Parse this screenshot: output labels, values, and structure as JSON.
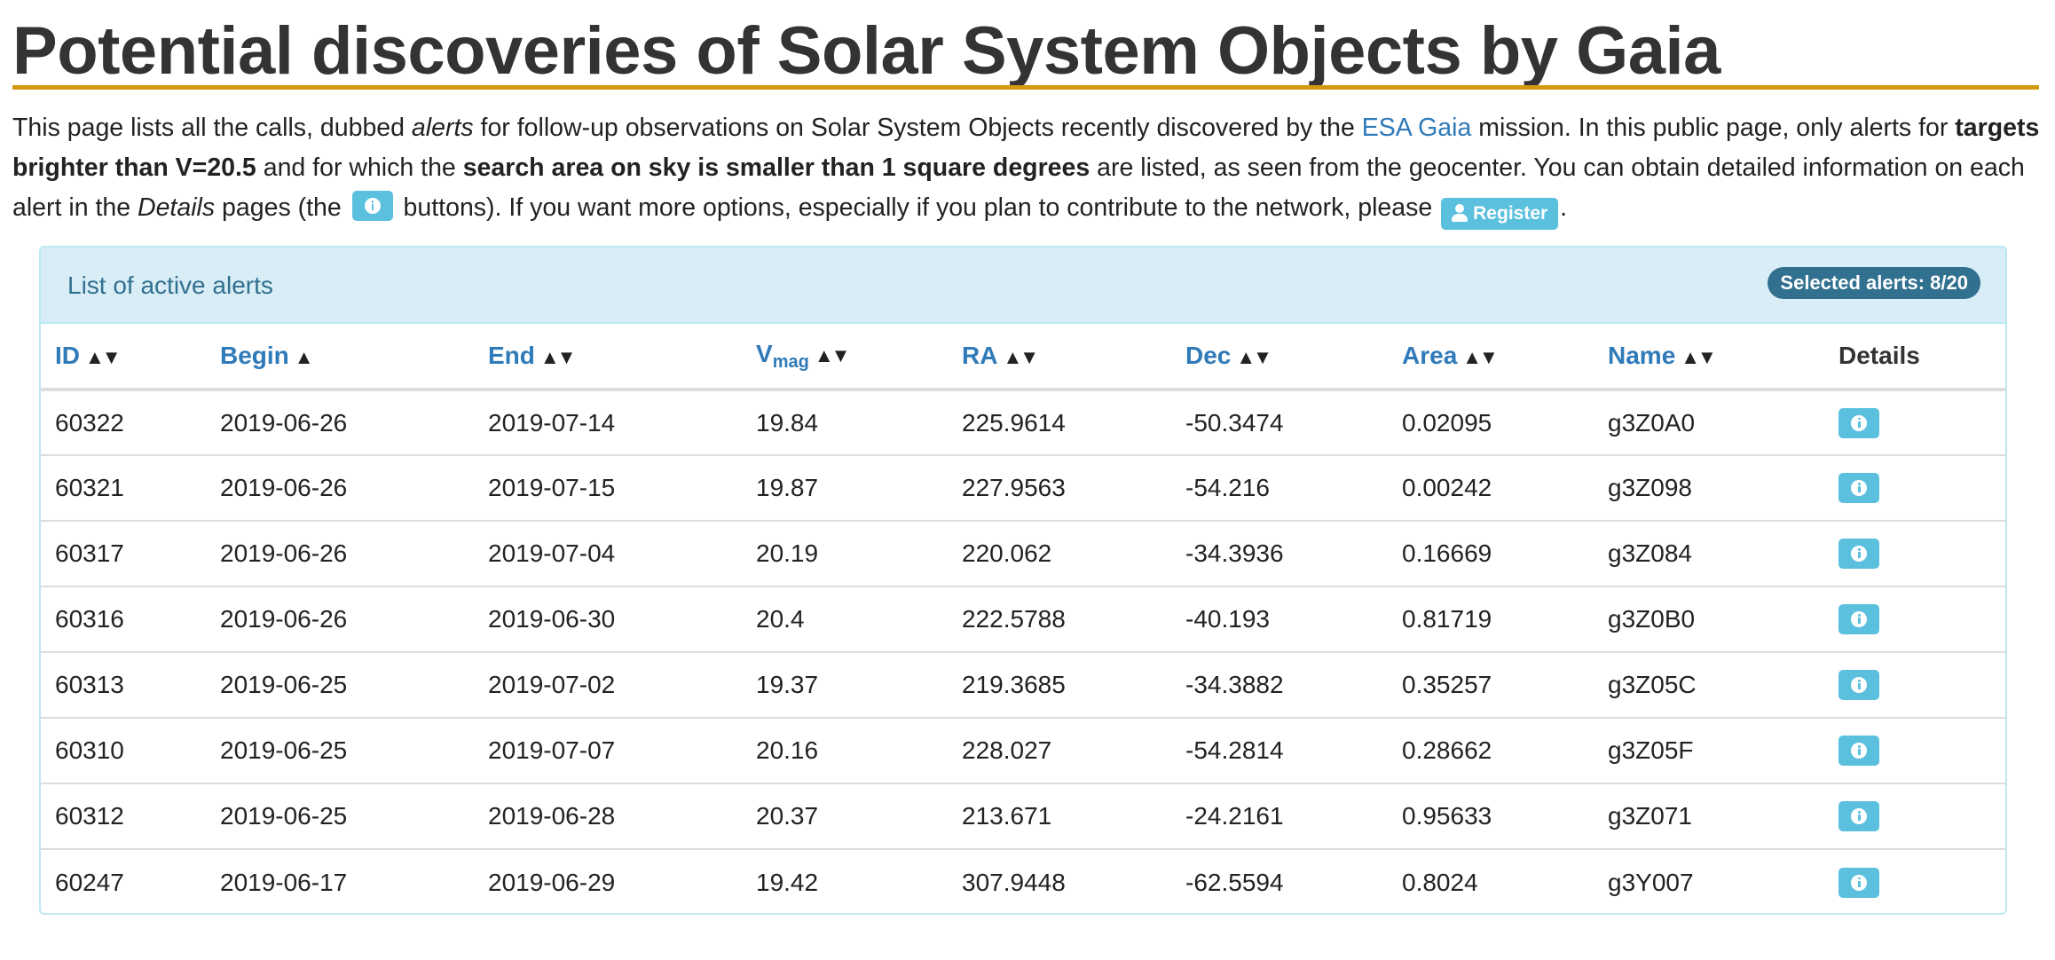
{
  "page": {
    "title": "Potential discoveries of Solar System Objects by Gaia"
  },
  "intro": {
    "t1": "This page lists all the calls, dubbed ",
    "t2_em": "alerts",
    "t3": " for follow-up observations on Solar System Objects recently discovered by the ",
    "link_esa": "ESA Gaia",
    "t4": " mission. In this public page, only alerts for ",
    "b1": "targets brighter than V=20.5",
    "t5": " and for which the ",
    "b2": "search area on sky is smaller than 1 square degrees",
    "t6": " are listed, as seen from the geocenter. You can obtain detailed information on each alert in the ",
    "em2": "Details",
    "t7": " pages (the ",
    "t8": " buttons). If you want more options, especially if you plan to contribute to the network, please ",
    "register_label": "Register",
    "t9": "."
  },
  "panel": {
    "title": "List of active alerts",
    "badge": "Selected alerts: 8/20"
  },
  "table": {
    "sort_arrows": "▲▼",
    "sort_up": "▲",
    "headers": {
      "id": "ID",
      "begin": "Begin",
      "end": "End",
      "vmag_main": "V",
      "vmag_sub": "mag",
      "ra": "RA",
      "dec": "Dec",
      "area": "Area",
      "name": "Name",
      "details": "Details"
    },
    "rows": [
      {
        "id": "60322",
        "begin": "2019-06-26",
        "end": "2019-07-14",
        "vmag": "19.84",
        "ra": "225.9614",
        "dec": "-50.3474",
        "area": "0.02095",
        "name": "g3Z0A0"
      },
      {
        "id": "60321",
        "begin": "2019-06-26",
        "end": "2019-07-15",
        "vmag": "19.87",
        "ra": "227.9563",
        "dec": "-54.216",
        "area": "0.00242",
        "name": "g3Z098"
      },
      {
        "id": "60317",
        "begin": "2019-06-26",
        "end": "2019-07-04",
        "vmag": "20.19",
        "ra": "220.062",
        "dec": "-34.3936",
        "area": "0.16669",
        "name": "g3Z084"
      },
      {
        "id": "60316",
        "begin": "2019-06-26",
        "end": "2019-06-30",
        "vmag": "20.4",
        "ra": "222.5788",
        "dec": "-40.193",
        "area": "0.81719",
        "name": "g3Z0B0"
      },
      {
        "id": "60313",
        "begin": "2019-06-25",
        "end": "2019-07-02",
        "vmag": "19.37",
        "ra": "219.3685",
        "dec": "-34.3882",
        "area": "0.35257",
        "name": "g3Z05C"
      },
      {
        "id": "60310",
        "begin": "2019-06-25",
        "end": "2019-07-07",
        "vmag": "20.16",
        "ra": "228.027",
        "dec": "-54.2814",
        "area": "0.28662",
        "name": "g3Z05F"
      },
      {
        "id": "60312",
        "begin": "2019-06-25",
        "end": "2019-06-28",
        "vmag": "20.37",
        "ra": "213.671",
        "dec": "-24.2161",
        "area": "0.95633",
        "name": "g3Z071"
      },
      {
        "id": "60247",
        "begin": "2019-06-17",
        "end": "2019-06-29",
        "vmag": "19.42",
        "ra": "307.9448",
        "dec": "-62.5594",
        "area": "0.8024",
        "name": "g3Y007"
      }
    ]
  },
  "icons": {
    "info": "info-circle-icon",
    "user": "user-icon"
  },
  "colors": {
    "title_rule": "#d29a0f",
    "link": "#2f7ab8",
    "info_button": "#5bc0de",
    "panel_heading_bg": "#d9edf7",
    "panel_border": "#bce8f1",
    "badge_bg": "#31708f"
  }
}
